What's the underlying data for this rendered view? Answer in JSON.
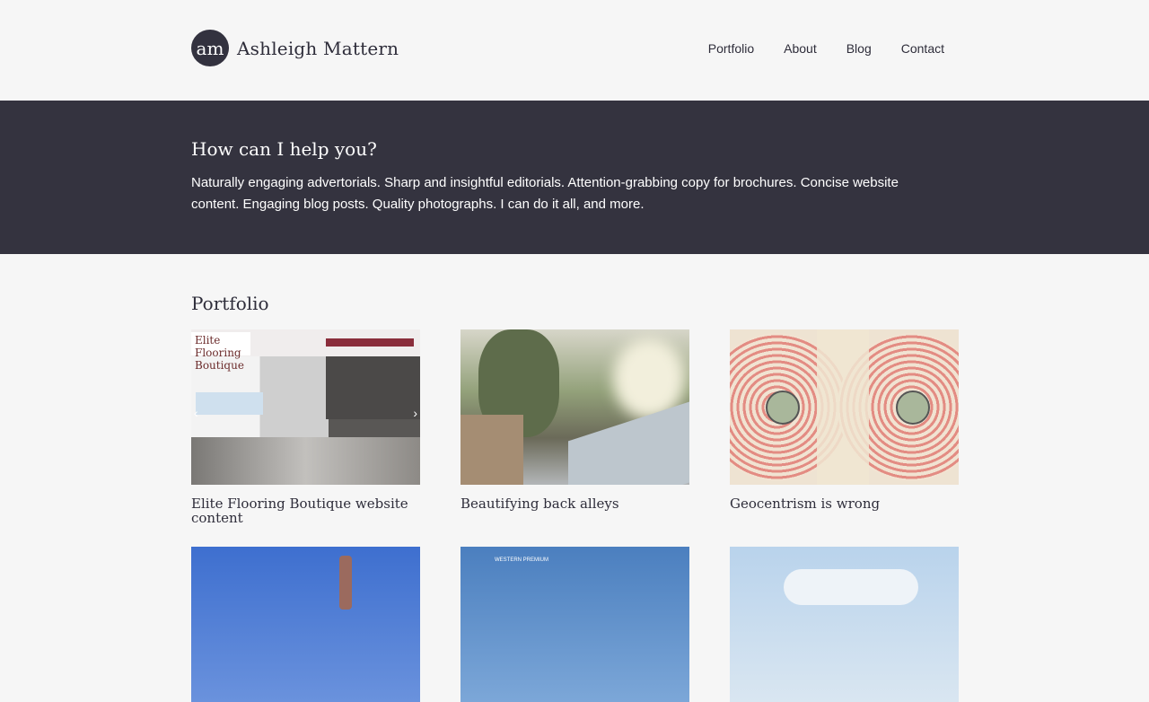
{
  "site": {
    "logo_text": "am",
    "title": "Ashleigh Mattern"
  },
  "nav": [
    "Portfolio",
    "About",
    "Blog",
    "Contact"
  ],
  "hero": {
    "heading": "How can I help you?",
    "text": "Naturally engaging advertorials. Sharp and insightful editorials. Attention-grabbing copy for brochures. Concise website content. Engaging blog posts. Quality photographs. I can do it all, and more."
  },
  "portfolio": {
    "heading": "Portfolio",
    "items": [
      {
        "caption": "Elite Flooring Boutique website content",
        "thumb_logo": "Elite Flooring Boutique"
      },
      {
        "caption": "Beautifying back alleys"
      },
      {
        "caption": "Geocentrism is wrong"
      },
      {
        "caption": ""
      },
      {
        "caption": "",
        "thumb_logo": "WESTERN PREMIUM"
      },
      {
        "caption": ""
      }
    ]
  },
  "colors": {
    "dark": "#34333f",
    "bg": "#f6f6f6",
    "accent": "#8a2d3b"
  }
}
